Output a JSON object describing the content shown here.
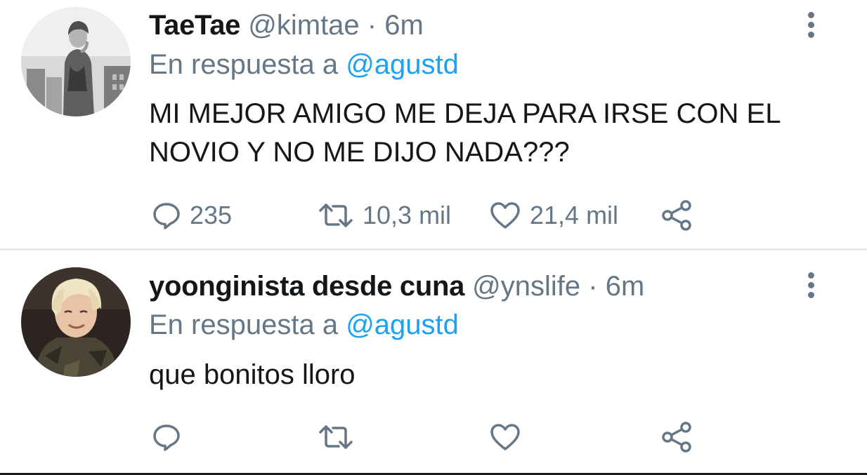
{
  "tweets": [
    {
      "name": "TaeTae",
      "handle": "@kimtae",
      "separator": "·",
      "time": "6m",
      "reply_prefix": "En respuesta a",
      "reply_mention": "@agustd",
      "text": "MI MEJOR AMIGO ME DEJA PARA IRSE CON EL NOVIO Y NO ME DIJO NADA???",
      "replies": "235",
      "retweets": "10,3 mil",
      "likes": "21,4 mil",
      "avatar": "grayscale-photo-avatar"
    },
    {
      "name": "yoonginista desde cuna",
      "handle": "@ynslife",
      "separator": "·",
      "time": "6m",
      "reply_prefix": "En respuesta a",
      "reply_mention": "@agustd",
      "text": "que bonitos lloro",
      "replies": "",
      "retweets": "",
      "likes": "",
      "avatar": "color-photo-avatar"
    }
  ],
  "icons": {
    "reply": "reply-icon",
    "retweet": "retweet-icon",
    "like": "heart-icon",
    "share": "share-icon",
    "more": "more-vertical-icon"
  },
  "colors": {
    "text": "#14171a",
    "secondary": "#657786",
    "link": "#1da1f2",
    "divider": "#e6ecf0"
  }
}
